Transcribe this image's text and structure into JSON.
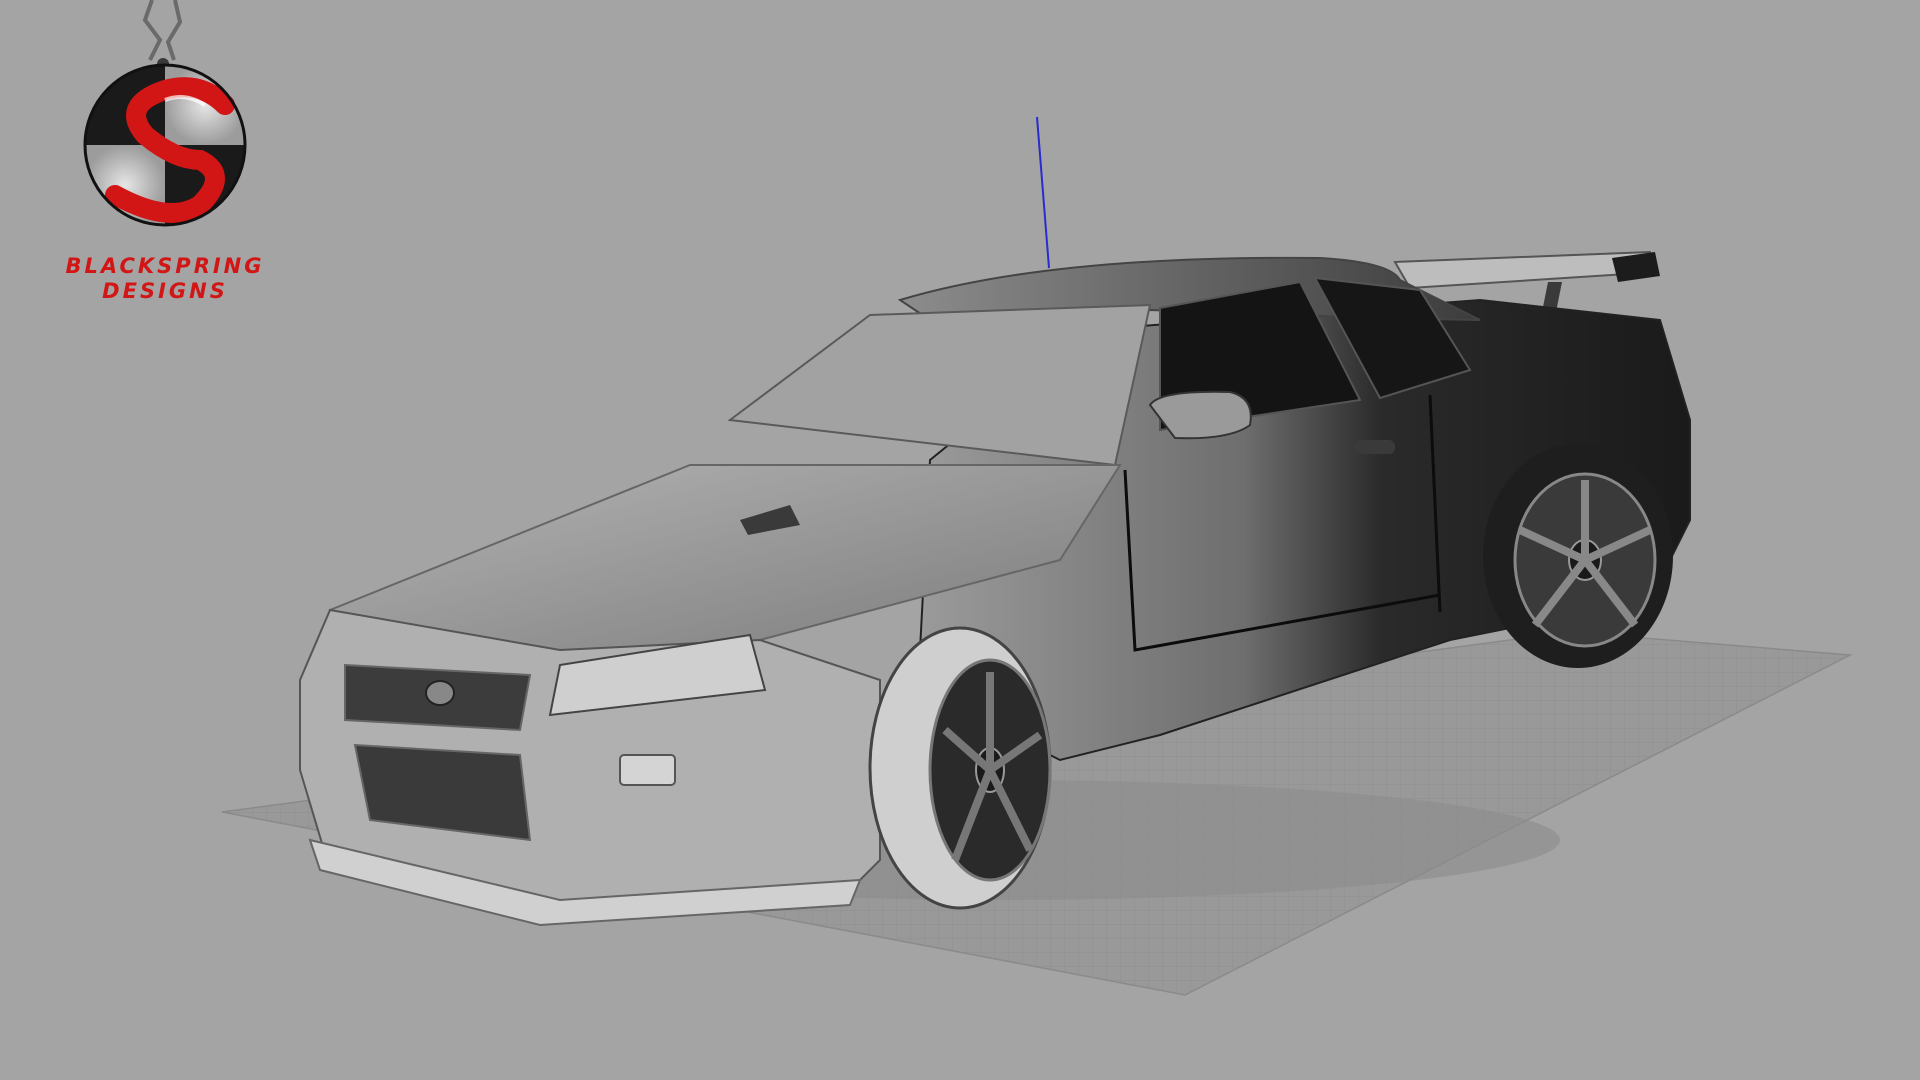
{
  "brand": {
    "line1": "BLACKSPRING",
    "line2": "DESIGNS",
    "logo_icon": "s-pendant-logo-icon",
    "accent_color": "#d21616"
  },
  "viewport": {
    "background_color": "#a4a4a4",
    "grid_color": "#8e8e8e",
    "axis_z_color": "#2a2ad0",
    "model_icon": "sports-car-3d-model"
  }
}
